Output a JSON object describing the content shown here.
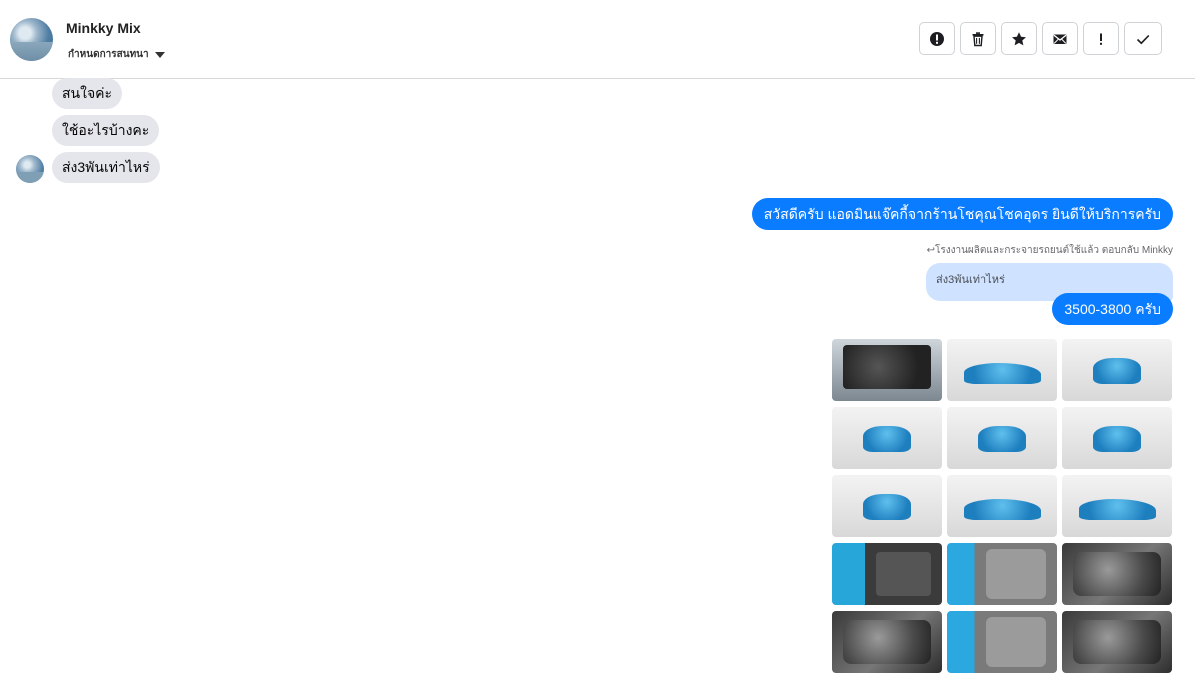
{
  "header": {
    "name": "Minkky Mix",
    "settings_label": "กำหนดการสนทนา",
    "toolbar": [
      {
        "name": "spam-alert-button",
        "icon": "alert-circle-icon"
      },
      {
        "name": "delete-button",
        "icon": "trash-icon"
      },
      {
        "name": "star-button",
        "icon": "star-icon"
      },
      {
        "name": "mark-unread-button",
        "icon": "envelope-icon"
      },
      {
        "name": "follow-up-button",
        "icon": "exclamation-icon"
      },
      {
        "name": "mark-done-button",
        "icon": "check-icon"
      }
    ]
  },
  "messages": {
    "incoming": [
      "สนใจค่ะ",
      "ใช้อะไรบ้างคะ",
      "ส่ง3พันเท่าไหร่"
    ],
    "greeting": "สวัสดีครับ แอดมินแจ๊คกี้จากร้านโชคุณโชคอุดร ยินดีให้บริการครับ",
    "reply_meta": "↩โรงงานผลิตและกระจายรถยนต์ใช้แล้ว ตอบกลับ Minkky",
    "quoted_text": "ส่ง3พันเท่าไหร่",
    "reply": "3500-3800 ครับ"
  },
  "photos": {
    "count_visible": 15,
    "kinds": [
      "engine",
      "side",
      "front",
      "front",
      "rear",
      "rear",
      "rear",
      "side",
      "side",
      "door",
      "seat",
      "interior",
      "interior",
      "seat",
      "interior"
    ]
  },
  "colors": {
    "outgoing_bubble": "#0a7cff",
    "incoming_bubble": "#e4e6eb",
    "quote_bubble": "#cfe2ff"
  }
}
